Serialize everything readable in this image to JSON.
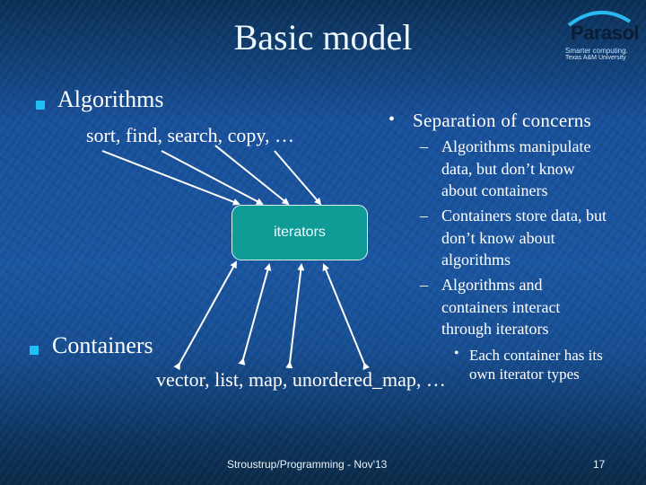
{
  "slide": {
    "title": "Basic model",
    "logo": {
      "name": "Parasol",
      "tagline_1": "Smarter computing.",
      "tagline_2": "Texas A&M University"
    },
    "left": {
      "algorithms": {
        "heading": "Algorithms",
        "examples": "sort, find, search, copy, …"
      },
      "center_box": "iterators",
      "containers": {
        "heading": "Containers",
        "examples": "vector, list, map, unordered_map, …"
      }
    },
    "right": {
      "heading": "Separation of concerns",
      "bullet_symbol": "•",
      "dash_symbol": "–",
      "items": [
        {
          "lines": [
            "Algorithms manipulate",
            "data, but don’t know",
            "about containers"
          ]
        },
        {
          "lines": [
            "Containers store data, but",
            "don’t know about",
            "algorithms"
          ]
        },
        {
          "lines": [
            "Algorithms and",
            "containers interact",
            "through iterators"
          ]
        }
      ],
      "sub_item": {
        "lines": [
          "Each container has its",
          "own iterator types"
        ]
      }
    },
    "footer": {
      "credit": "Stroustrup/Programming - Nov'13",
      "page_number": "17"
    },
    "colors": {
      "bullet": "#1fc0f5",
      "box_fill": "#109b96",
      "background": "#1a55a0"
    }
  }
}
